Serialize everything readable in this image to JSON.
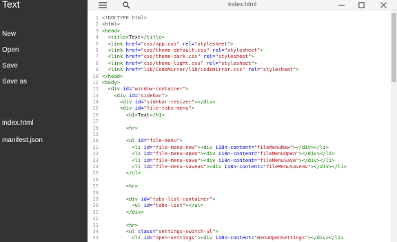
{
  "sidebar": {
    "title": "Text",
    "menu": [
      "New",
      "Open",
      "Save",
      "Save as"
    ],
    "files": [
      "index.html",
      "manifest.json"
    ]
  },
  "editor": {
    "filename": "index.html",
    "lines": [
      [
        [
          "meta",
          "<!DOCTYPE html>"
        ]
      ],
      [
        [
          "tag",
          "<html>"
        ]
      ],
      [
        [
          "tag",
          "<head>"
        ]
      ],
      [
        [
          "tx",
          "  "
        ],
        [
          "tag",
          "<title>"
        ],
        [
          "tx",
          "Text"
        ],
        [
          "tag",
          "</title>"
        ]
      ],
      [
        [
          "tx",
          "  "
        ],
        [
          "tag",
          "<link "
        ],
        [
          "attr",
          "href="
        ],
        [
          "str",
          "\"css/app.css\""
        ],
        [
          "tx",
          " "
        ],
        [
          "attr",
          "rel="
        ],
        [
          "str",
          "\"stylesheet\""
        ],
        [
          "tag",
          ">"
        ]
      ],
      [
        [
          "tx",
          "  "
        ],
        [
          "tag",
          "<link "
        ],
        [
          "attr",
          "href="
        ],
        [
          "str",
          "\"css/theme-default.css\""
        ],
        [
          "tx",
          " "
        ],
        [
          "attr",
          "rel="
        ],
        [
          "str",
          "\"stylesheet\""
        ],
        [
          "tag",
          ">"
        ]
      ],
      [
        [
          "tx",
          "  "
        ],
        [
          "tag",
          "<link "
        ],
        [
          "attr",
          "href="
        ],
        [
          "str",
          "\"css/theme-dark.css\""
        ],
        [
          "tx",
          " "
        ],
        [
          "attr",
          "rel="
        ],
        [
          "str",
          "\"stylesheet\""
        ],
        [
          "tag",
          ">"
        ]
      ],
      [
        [
          "tx",
          "  "
        ],
        [
          "tag",
          "<link "
        ],
        [
          "attr",
          "href="
        ],
        [
          "str",
          "\"css/theme-light.css\""
        ],
        [
          "tx",
          " "
        ],
        [
          "attr",
          "rel="
        ],
        [
          "str",
          "\"stylesheet\""
        ],
        [
          "tag",
          ">"
        ]
      ],
      [
        [
          "tx",
          "  "
        ],
        [
          "tag",
          "<link "
        ],
        [
          "attr",
          "href="
        ],
        [
          "str",
          "\"lib/CodeMirror/lib/codemirror.css\""
        ],
        [
          "tx",
          " "
        ],
        [
          "attr",
          "rel="
        ],
        [
          "str",
          "\"stylesheet\""
        ],
        [
          "tag",
          ">"
        ]
      ],
      [
        [
          "tag",
          "</head>"
        ]
      ],
      [
        [
          "tag",
          "<body>"
        ]
      ],
      [
        [
          "tx",
          "  "
        ],
        [
          "tag",
          "<div "
        ],
        [
          "attr",
          "id="
        ],
        [
          "str",
          "\"window-container\""
        ],
        [
          "tag",
          ">"
        ]
      ],
      [
        [
          "tx",
          "    "
        ],
        [
          "tag",
          "<div "
        ],
        [
          "attr",
          "id="
        ],
        [
          "str",
          "\"sidebar\""
        ],
        [
          "tag",
          ">"
        ]
      ],
      [
        [
          "tx",
          "      "
        ],
        [
          "tag",
          "<div "
        ],
        [
          "attr",
          "id="
        ],
        [
          "str",
          "\"sidebar-resizer\""
        ],
        [
          "tag",
          "></div>"
        ]
      ],
      [
        [
          "tx",
          "      "
        ],
        [
          "tag",
          "<div "
        ],
        [
          "attr",
          "id="
        ],
        [
          "str",
          "\"file-tabs-menu\""
        ],
        [
          "tag",
          ">"
        ]
      ],
      [
        [
          "tx",
          "        "
        ],
        [
          "tag",
          "<h1>"
        ],
        [
          "tx",
          "Text"
        ],
        [
          "tag",
          "</h1>"
        ]
      ],
      [],
      [
        [
          "tx",
          "        "
        ],
        [
          "tag",
          "<hr>"
        ]
      ],
      [],
      [
        [
          "tx",
          "        "
        ],
        [
          "tag",
          "<ul "
        ],
        [
          "attr",
          "id="
        ],
        [
          "str",
          "\"file-menu\""
        ],
        [
          "tag",
          ">"
        ]
      ],
      [
        [
          "tx",
          "          "
        ],
        [
          "tag",
          "<li "
        ],
        [
          "attr",
          "id="
        ],
        [
          "str",
          "\"file-menu-new\""
        ],
        [
          "tag",
          "><div "
        ],
        [
          "attr",
          "i18n-content="
        ],
        [
          "str",
          "\"fileMenuNew\""
        ],
        [
          "tag",
          "></div></li>"
        ]
      ],
      [
        [
          "tx",
          "          "
        ],
        [
          "tag",
          "<li "
        ],
        [
          "attr",
          "id="
        ],
        [
          "str",
          "\"file-menu-open\""
        ],
        [
          "tag",
          "><div "
        ],
        [
          "attr",
          "i18n-content="
        ],
        [
          "str",
          "\"fileMenuOpen\""
        ],
        [
          "tag",
          "></div></li>"
        ]
      ],
      [
        [
          "tx",
          "          "
        ],
        [
          "tag",
          "<li "
        ],
        [
          "attr",
          "id="
        ],
        [
          "str",
          "\"file-menu-save\""
        ],
        [
          "tag",
          "><div "
        ],
        [
          "attr",
          "i18n-content="
        ],
        [
          "str",
          "\"fileMenuSave\""
        ],
        [
          "tag",
          "></div></li>"
        ]
      ],
      [
        [
          "tx",
          "          "
        ],
        [
          "tag",
          "<li "
        ],
        [
          "attr",
          "id="
        ],
        [
          "str",
          "\"file-menu-saveas\""
        ],
        [
          "tag",
          "><div "
        ],
        [
          "attr",
          "i18n-content="
        ],
        [
          "str",
          "\"fileMenuSaveas\""
        ],
        [
          "tag",
          "></div></li>"
        ]
      ],
      [
        [
          "tx",
          "        "
        ],
        [
          "tag",
          "</ul>"
        ]
      ],
      [],
      [
        [
          "tx",
          "        "
        ],
        [
          "tag",
          "<hr>"
        ]
      ],
      [],
      [
        [
          "tx",
          "        "
        ],
        [
          "tag",
          "<div "
        ],
        [
          "attr",
          "id="
        ],
        [
          "str",
          "\"tabs-list-container\""
        ],
        [
          "tag",
          ">"
        ]
      ],
      [
        [
          "tx",
          "          "
        ],
        [
          "tag",
          "<ul "
        ],
        [
          "attr",
          "id="
        ],
        [
          "str",
          "\"tabs-list\""
        ],
        [
          "tag",
          "></ul>"
        ]
      ],
      [
        [
          "tx",
          "        "
        ],
        [
          "tag",
          "</div>"
        ]
      ],
      [],
      [
        [
          "tx",
          "        "
        ],
        [
          "tag",
          "<hr>"
        ]
      ],
      [
        [
          "tx",
          "        "
        ],
        [
          "tag",
          "<ul "
        ],
        [
          "attr",
          "class="
        ],
        [
          "str",
          "\"settings-switch-ul\""
        ],
        [
          "tag",
          ">"
        ]
      ],
      [
        [
          "tx",
          "          "
        ],
        [
          "tag",
          "<li "
        ],
        [
          "attr",
          "id="
        ],
        [
          "str",
          "\"open-settings\""
        ],
        [
          "tag",
          "><div "
        ],
        [
          "attr",
          "i18n-content="
        ],
        [
          "str",
          "\"menuOpenSettings\""
        ],
        [
          "tag",
          "></div></li>"
        ]
      ]
    ]
  },
  "icons": {
    "menu": "hamburger-menu-icon",
    "search": "search-icon",
    "minimize": "minimize-icon",
    "maximize": "maximize-icon",
    "close": "close-icon"
  },
  "colors": {
    "sidebar_bg": "#333333",
    "tag": "#117700",
    "attribute": "#0000cc",
    "string": "#aa1111"
  }
}
